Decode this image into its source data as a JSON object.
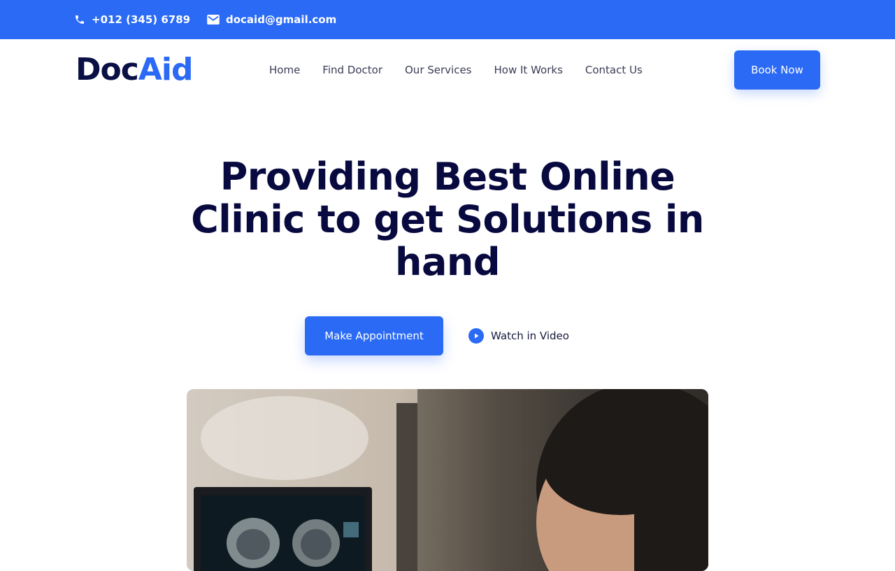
{
  "topbar": {
    "phone": "+012 (345) 6789",
    "email": "docaid@gmail.com"
  },
  "logo": {
    "part1": "Doc",
    "part2": "Aid"
  },
  "nav": {
    "items": [
      {
        "label": "Home"
      },
      {
        "label": "Find Doctor"
      },
      {
        "label": "Our Services"
      },
      {
        "label": "How It Works"
      },
      {
        "label": "Contact Us"
      }
    ],
    "book_label": "Book Now"
  },
  "hero": {
    "title": "Providing Best Online Clinic to get Solutions in hand",
    "appointment_label": "Make Appointment",
    "watch_label": "Watch in Video"
  },
  "colors": {
    "brand_blue": "#2a6af5",
    "navy": "#07093f"
  },
  "icons": [
    "phone-icon",
    "mail-icon",
    "play-icon"
  ]
}
